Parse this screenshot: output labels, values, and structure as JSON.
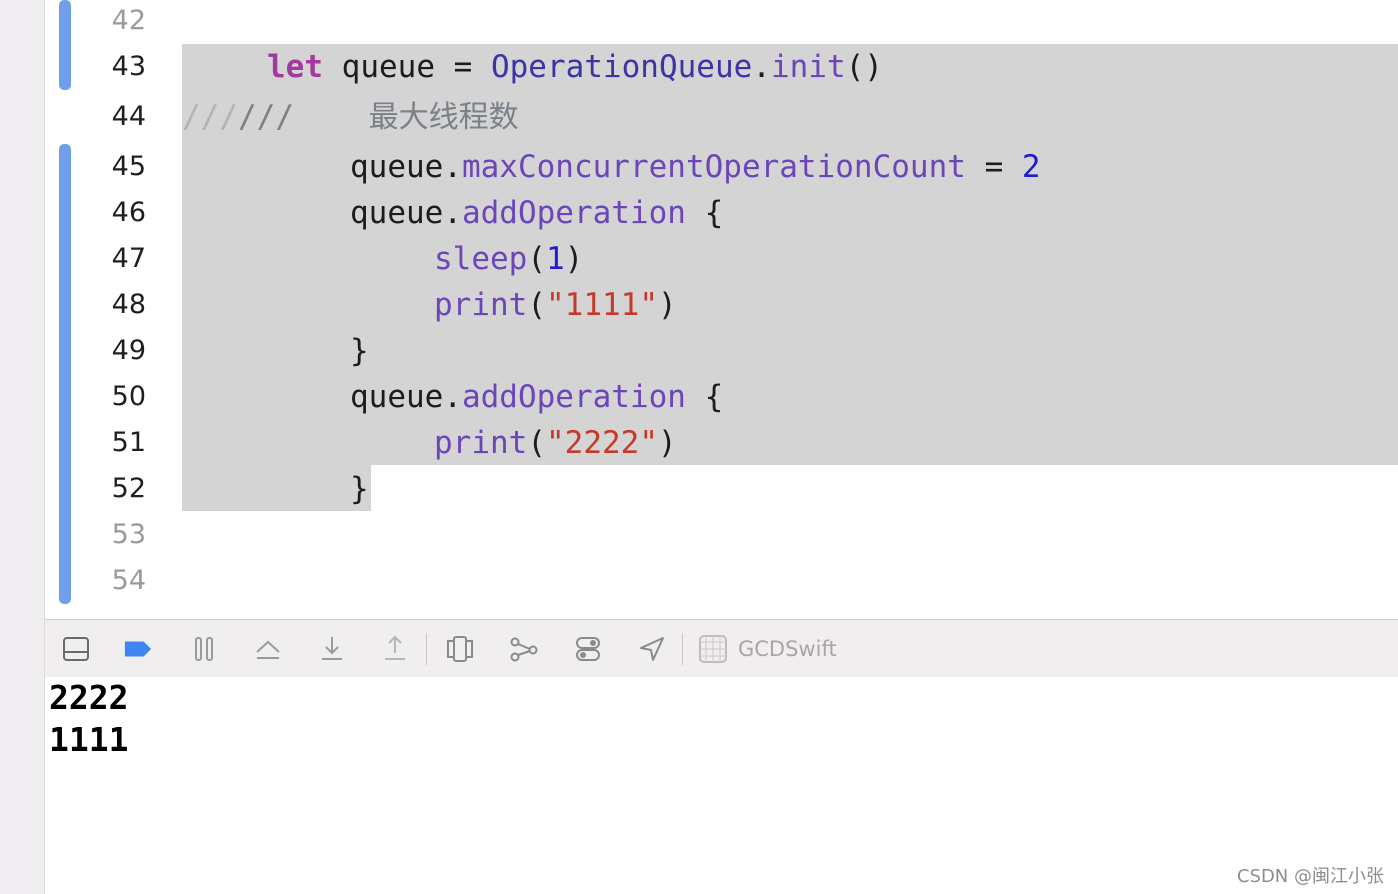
{
  "editor": {
    "line_numbers": [
      "42",
      "43",
      "44",
      "45",
      "46",
      "47",
      "48",
      "49",
      "50",
      "51",
      "52",
      "53",
      "54"
    ],
    "code": {
      "l43": {
        "indent": "  ",
        "kw": "let",
        "t1": " queue = ",
        "type": "OperationQueue",
        "dot": ".",
        "m": "init",
        "tail": "()"
      },
      "l44": {
        "slashes_dim": "///",
        "slashes": "///",
        "sp": "    ",
        "comment": "最大线程数"
      },
      "l45": {
        "indent": "    ",
        "t1": "queue.",
        "m": "maxConcurrentOperationCount",
        "t2": " = ",
        "num": "2"
      },
      "l46": {
        "indent": "    ",
        "t1": "queue.",
        "m": "addOperation",
        "t2": " {"
      },
      "l47": {
        "indent": "        ",
        "m": "sleep",
        "t1": "(",
        "num": "1",
        "t2": ")"
      },
      "l48": {
        "indent": "        ",
        "m": "print",
        "t1": "(",
        "str": "\"1111\"",
        "t2": ")"
      },
      "l49": {
        "indent": "    ",
        "t1": "}"
      },
      "l50": {
        "indent": "    ",
        "t1": "queue.",
        "m": "addOperation",
        "t2": " {"
      },
      "l51": {
        "indent": "        ",
        "m": "print",
        "t1": "(",
        "str": "\"2222\"",
        "t2": ")"
      },
      "l52": {
        "indent": "    ",
        "t1": "}"
      }
    }
  },
  "toolbar": {
    "icons": [
      "hide-debug-area-icon",
      "breakpoints-icon",
      "pause-icon",
      "step-over-icon",
      "step-into-icon",
      "step-out-icon",
      "view-hierarchy-icon",
      "memory-graph-icon",
      "environment-overrides-icon",
      "location-icon",
      "scheme-icon"
    ],
    "target_label": "GCDSwift"
  },
  "console": {
    "lines": [
      "2222",
      "1111"
    ]
  },
  "watermark": "CSDN @闽江小张",
  "colors": {
    "keyword": "#a3389e",
    "type": "#3a34a7",
    "method": "#6c46b8",
    "number": "#1f1ccc",
    "string": "#c4392a",
    "selection": "#d4d4d4",
    "change_bar": "#6f9fea"
  }
}
